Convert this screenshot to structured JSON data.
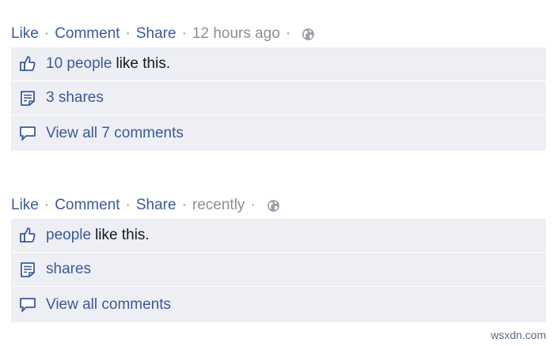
{
  "posts": [
    {
      "actions": {
        "like": "Like",
        "comment": "Comment",
        "share": "Share",
        "time": "12 hours ago"
      },
      "likes": {
        "link": "10 people",
        "text": "like this."
      },
      "shares": {
        "link": "3 shares"
      },
      "comments": {
        "link": "View all 7 comments"
      }
    },
    {
      "actions": {
        "like": "Like",
        "comment": "Comment",
        "share": "Share",
        "time": "recently"
      },
      "likes": {
        "link": "people",
        "text": "like this."
      },
      "shares": {
        "link": "shares"
      },
      "comments": {
        "link": "View all comments"
      }
    }
  ],
  "watermark": "wsxdn.com",
  "colors": {
    "link": "#3b5998",
    "muted": "#8b8f96",
    "box_bg": "#edeff4",
    "text": "#141823"
  },
  "icons": {
    "globe": "globe-icon",
    "like": "thumbs-up-icon",
    "share": "share-icon",
    "comment": "comment-bubble-icon"
  }
}
